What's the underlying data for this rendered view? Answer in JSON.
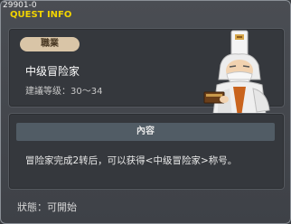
{
  "window": {
    "quest_id": "29901-0",
    "title": "QUEST INFO"
  },
  "job": {
    "pill_label": "職業",
    "name": "中级冒险家",
    "recommended_level": "建議等级：30～34"
  },
  "content": {
    "header": "內容",
    "text": "冒险家完成2转后，可以获得<中级冒险家>称号。"
  },
  "status": "狀態：可開始",
  "colors": {
    "title": "#f2d400",
    "pill_bg": "#d9c5a7",
    "content_header_bg": "#515c65"
  },
  "npc": {
    "icon": "elder-sage-npc"
  }
}
